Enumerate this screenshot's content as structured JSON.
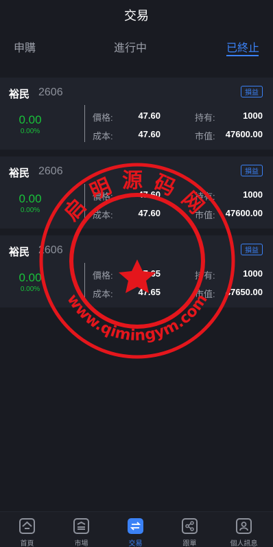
{
  "header": {
    "title": "交易"
  },
  "tabs": [
    {
      "label": "申購"
    },
    {
      "label": "進行中"
    },
    {
      "label": "已終止"
    }
  ],
  "cards": [
    {
      "name": "裕民",
      "code": "2606",
      "badge": "損益",
      "change": "0.00",
      "change_pct": "0.00%",
      "price_label": "價格:",
      "price": "47.60",
      "hold_label": "持有:",
      "hold": "1000",
      "cost_label": "成本:",
      "cost": "47.60",
      "mv_label": "市值:",
      "mv": "47600.00"
    },
    {
      "name": "裕民",
      "code": "2606",
      "badge": "損益",
      "change": "0.00",
      "change_pct": "0.00%",
      "price_label": "價格:",
      "price": "47.60",
      "hold_label": "持有:",
      "hold": "1000",
      "cost_label": "成本:",
      "cost": "47.60",
      "mv_label": "市值:",
      "mv": "47600.00"
    },
    {
      "name": "裕民",
      "code": "2606",
      "badge": "損益",
      "change": "0.00",
      "change_pct": "0.00%",
      "price_label": "價格:",
      "price": "47.65",
      "hold_label": "持有:",
      "hold": "1000",
      "cost_label": "成本:",
      "cost": "47.65",
      "mv_label": "市值:",
      "mv": "47650.00"
    }
  ],
  "watermark": {
    "chars": [
      "启",
      "明",
      "源",
      "码",
      "网"
    ],
    "url": "www.qimingym.com",
    "color": "#e4161c"
  },
  "bottom_nav": [
    {
      "label": "首頁",
      "icon": "home-icon"
    },
    {
      "label": "市場",
      "icon": "market-icon"
    },
    {
      "label": "交易",
      "icon": "trade-icon"
    },
    {
      "label": "跟單",
      "icon": "share-icon"
    },
    {
      "label": "個人訊息",
      "icon": "user-icon"
    }
  ],
  "colors": {
    "accent": "#3b82f6",
    "up": "#19c23a",
    "background": "#191b22",
    "card": "#20232c"
  }
}
